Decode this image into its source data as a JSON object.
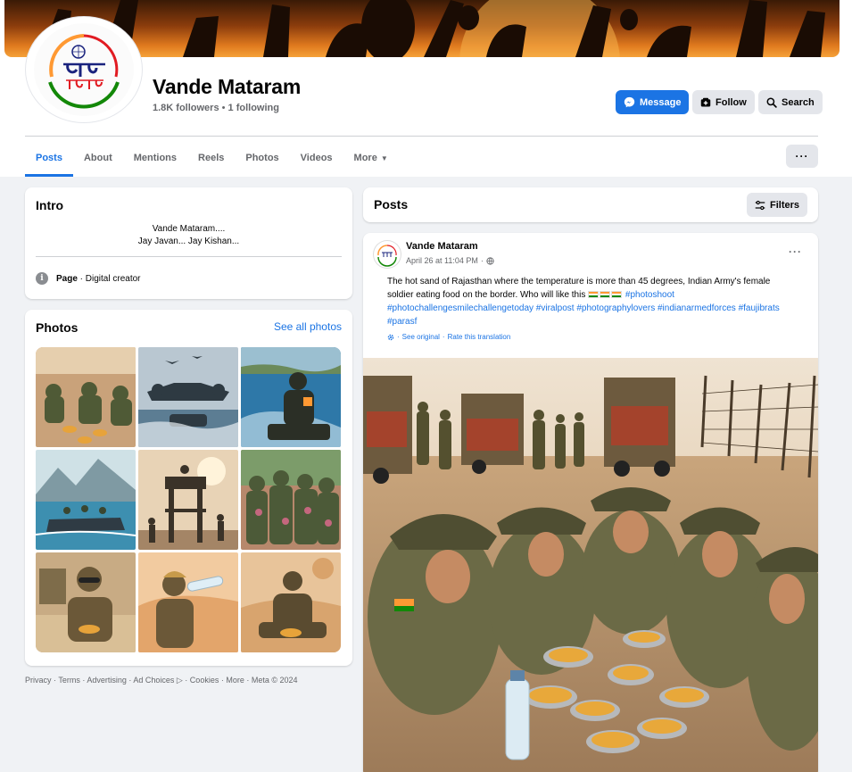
{
  "page": {
    "name": "Vande Mataram",
    "followers": "1.8K followers",
    "following": "1 following",
    "bullet": " • ",
    "logo_text": "वंदे मातरम"
  },
  "actions": {
    "message": "Message",
    "follow": "Follow",
    "search": "Search"
  },
  "tabs": [
    "Posts",
    "About",
    "Mentions",
    "Reels",
    "Photos",
    "Videos",
    "More"
  ],
  "tab_more_button": "···",
  "intro": {
    "title": "Intro",
    "bio_line1": "Vande Mataram....",
    "bio_line2": "Jay Javan... Jay Kishan...",
    "category_prefix": "Page",
    "category": " · Digital creator"
  },
  "photos": {
    "title": "Photos",
    "see_all": "See all photos"
  },
  "footer": "Privacy · Terms · Advertising · Ad Choices ▷ · Cookies · More · Meta © 2024",
  "posts_header": {
    "title": "Posts",
    "filters": "Filters"
  },
  "post": {
    "author": "Vande Mataram",
    "date": "April 26 at 11:04 PM",
    "meta_sep": " · ",
    "menu": "···",
    "text_main": "The hot sand of Rajasthan where the temperature is more than 45 degrees, Indian Army's female soldier eating food on the border. Who will like this ",
    "hashtags_line1": "#photoshoot",
    "hashtags_rest": "#photochallengesmilechallengetoday #viralpost #photographylovers #indianarmedforces #faujibrats #parasf",
    "see_original": "See original",
    "dot": " · ",
    "rate_translation": "Rate this translation"
  },
  "colors": {
    "accent": "#1b74e4",
    "background": "#f0f2f5",
    "secondary_text": "#65676b"
  }
}
